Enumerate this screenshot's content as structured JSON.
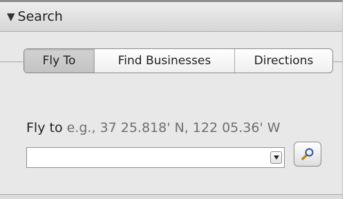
{
  "panel": {
    "header_title": "Search",
    "disclosure_icon": "disclosure-triangle-down-icon"
  },
  "tabs": [
    {
      "label": "Fly To",
      "active": true
    },
    {
      "label": "Find Businesses",
      "active": false
    },
    {
      "label": "Directions",
      "active": false
    }
  ],
  "fly_to": {
    "label": "Fly to",
    "hint": "e.g., 37 25.818' N, 122 05.36' W",
    "input_value": "",
    "dropdown_icon": "dropdown-arrow-icon",
    "search_icon": "magnifier-icon"
  },
  "colors": {
    "panel_bg": "#e8e8e8",
    "hint_text": "#6e6e6e",
    "magnifier_handle": "#c8820f",
    "magnifier_lens": "#2f4f8a"
  }
}
